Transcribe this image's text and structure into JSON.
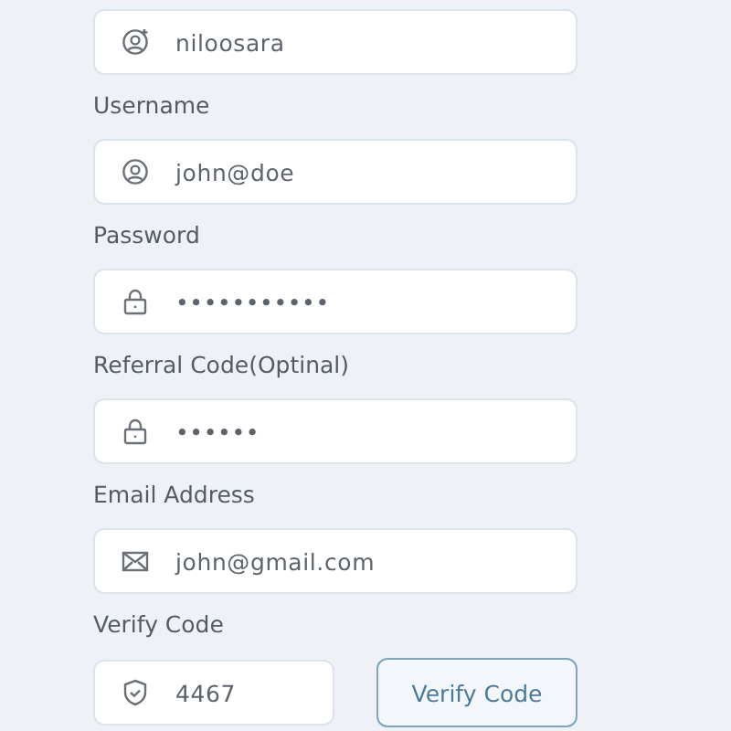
{
  "fields": [
    {
      "kind": "account",
      "value": "niloosara"
    },
    {
      "label": "Username",
      "kind": "login",
      "value": "john@doe"
    },
    {
      "label": "Password",
      "kind": "password",
      "value": "•••••••••••"
    },
    {
      "label": "Referral Code(Optinal)",
      "kind": "password",
      "value": "••••••"
    },
    {
      "label": "Email Address",
      "kind": "email",
      "value": "john@gmail.com"
    },
    {
      "label": "Verify Code",
      "kind": "code",
      "value": "4467",
      "button": "Verify Code"
    }
  ]
}
